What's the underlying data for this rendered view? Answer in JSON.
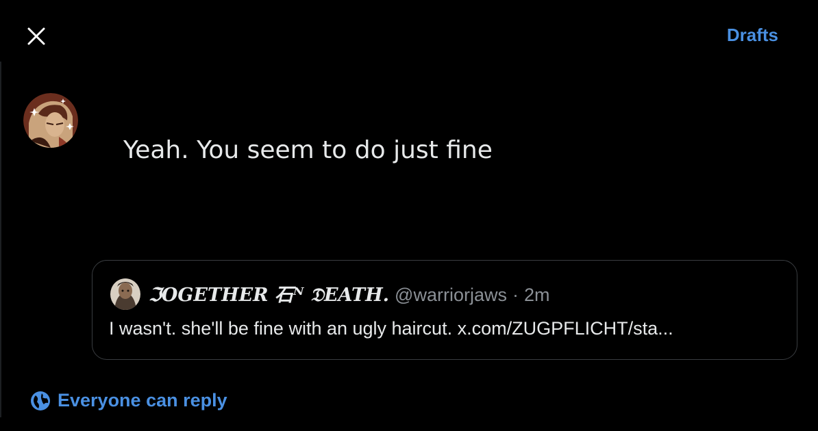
{
  "header": {
    "close_icon": "close-icon",
    "drafts_label": "Drafts"
  },
  "composer": {
    "avatar": "user-avatar",
    "text": "Yeah. You seem to do just fine"
  },
  "quote": {
    "avatar": "quoted-user-avatar",
    "display_name": "ℑOGETHER ⽯ᴺ 𝔇EATH.",
    "handle": "@warriorjaws",
    "separator": "·",
    "time": "2m",
    "body": "I wasn't. she'll be fine with an ugly haircut. x.com/ZUGPFLICHT/sta..."
  },
  "reply_setting": {
    "icon": "globe-icon",
    "label": "Everyone can reply"
  },
  "colors": {
    "background": "#000000",
    "accent": "#4a90e2",
    "text_primary": "#e7e9ea",
    "text_secondary": "#8b9096",
    "border": "#3a3d41"
  }
}
